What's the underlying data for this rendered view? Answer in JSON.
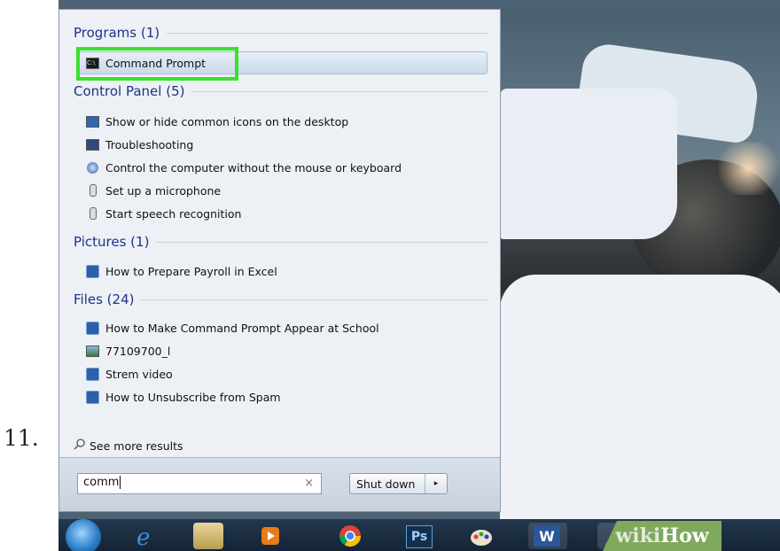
{
  "step_number": "11.",
  "sections": {
    "programs": {
      "header": "Programs (1)",
      "items": [
        {
          "label": "Command Prompt",
          "icon": "cmd-icon"
        }
      ]
    },
    "control_panel": {
      "header": "Control Panel (5)",
      "items": [
        {
          "label": "Show or hide common icons on the desktop",
          "icon": "monitor-icon"
        },
        {
          "label": "Troubleshooting",
          "icon": "troubleshooting-icon"
        },
        {
          "label": "Control the computer without the mouse or keyboard",
          "icon": "ease-of-access-icon"
        },
        {
          "label": "Set up a microphone",
          "icon": "microphone-icon"
        },
        {
          "label": "Start speech recognition",
          "icon": "microphone-icon"
        }
      ]
    },
    "pictures": {
      "header": "Pictures (1)",
      "items": [
        {
          "label": "How to Prepare Payroll in Excel",
          "icon": "document-icon"
        }
      ]
    },
    "files": {
      "header": "Files (24)",
      "items": [
        {
          "label": "How to Make Command Prompt Appear at School",
          "icon": "document-icon"
        },
        {
          "label": "77109700_l",
          "icon": "image-icon"
        },
        {
          "label": "Strem video",
          "icon": "document-icon"
        },
        {
          "label": "How to Unsubscribe from Spam",
          "icon": "document-icon"
        }
      ]
    }
  },
  "see_more": "See more results",
  "search": {
    "value": "comm",
    "clear_glyph": "×"
  },
  "shutdown": {
    "label": "Shut down",
    "arrow": "▸"
  },
  "taskbar": {
    "icons": [
      "start-orb-icon",
      "internet-explorer-icon",
      "file-explorer-icon",
      "media-player-icon",
      "chrome-icon",
      "photoshop-icon",
      "paint-icon",
      "word-icon",
      "app-icon"
    ],
    "photoshop_label": "Ps",
    "word_label": "W"
  },
  "watermark": {
    "wiki": "wiki",
    "how": "How"
  },
  "colors": {
    "highlight_border": "#37e22b",
    "header_text": "#1e3287",
    "menu_bg": "#edf1f5"
  }
}
